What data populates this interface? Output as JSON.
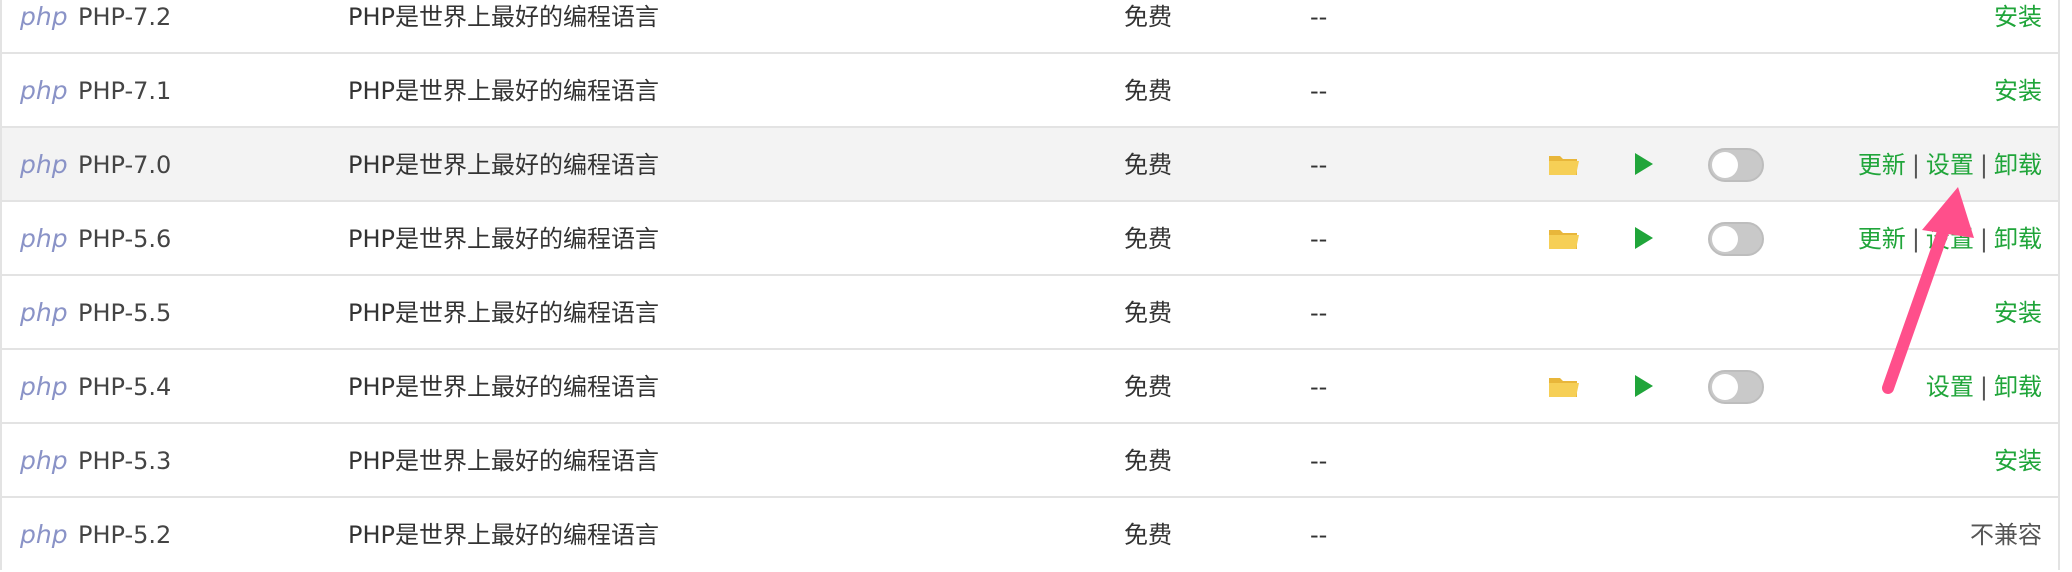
{
  "accent_color": "#20a53a",
  "annotation_color": "#ff4f8b",
  "rows": [
    {
      "logo": "php",
      "name": "PHP-7.2",
      "desc": "PHP是世界上最好的编程语言",
      "price": "免费",
      "expire": "--",
      "actions": [
        "安装"
      ],
      "installed": false
    },
    {
      "logo": "php",
      "name": "PHP-7.1",
      "desc": "PHP是世界上最好的编程语言",
      "price": "免费",
      "expire": "--",
      "actions": [
        "安装"
      ],
      "installed": false
    },
    {
      "logo": "php",
      "name": "PHP-7.0",
      "desc": "PHP是世界上最好的编程语言",
      "price": "免费",
      "expire": "--",
      "actions": [
        "更新",
        "设置",
        "卸载"
      ],
      "installed": true,
      "toggle_on": false,
      "highlight": true
    },
    {
      "logo": "php",
      "name": "PHP-5.6",
      "desc": "PHP是世界上最好的编程语言",
      "price": "免费",
      "expire": "--",
      "actions": [
        "更新",
        "设置",
        "卸载"
      ],
      "installed": true,
      "toggle_on": false
    },
    {
      "logo": "php",
      "name": "PHP-5.5",
      "desc": "PHP是世界上最好的编程语言",
      "price": "免费",
      "expire": "--",
      "actions": [
        "安装"
      ],
      "installed": false
    },
    {
      "logo": "php",
      "name": "PHP-5.4",
      "desc": "PHP是世界上最好的编程语言",
      "price": "免费",
      "expire": "--",
      "actions": [
        "设置",
        "卸载"
      ],
      "installed": true,
      "toggle_on": false
    },
    {
      "logo": "php",
      "name": "PHP-5.3",
      "desc": "PHP是世界上最好的编程语言",
      "price": "免费",
      "expire": "--",
      "actions": [
        "安装"
      ],
      "installed": false
    },
    {
      "logo": "php",
      "name": "PHP-5.2",
      "desc": "PHP是世界上最好的编程语言",
      "price": "免费",
      "expire": "--",
      "actions": [
        "不兼容"
      ],
      "installed": false,
      "incompatible": true
    }
  ],
  "icons": {
    "folder": "folder-icon",
    "play": "play-icon",
    "toggle": "toggle-switch"
  }
}
